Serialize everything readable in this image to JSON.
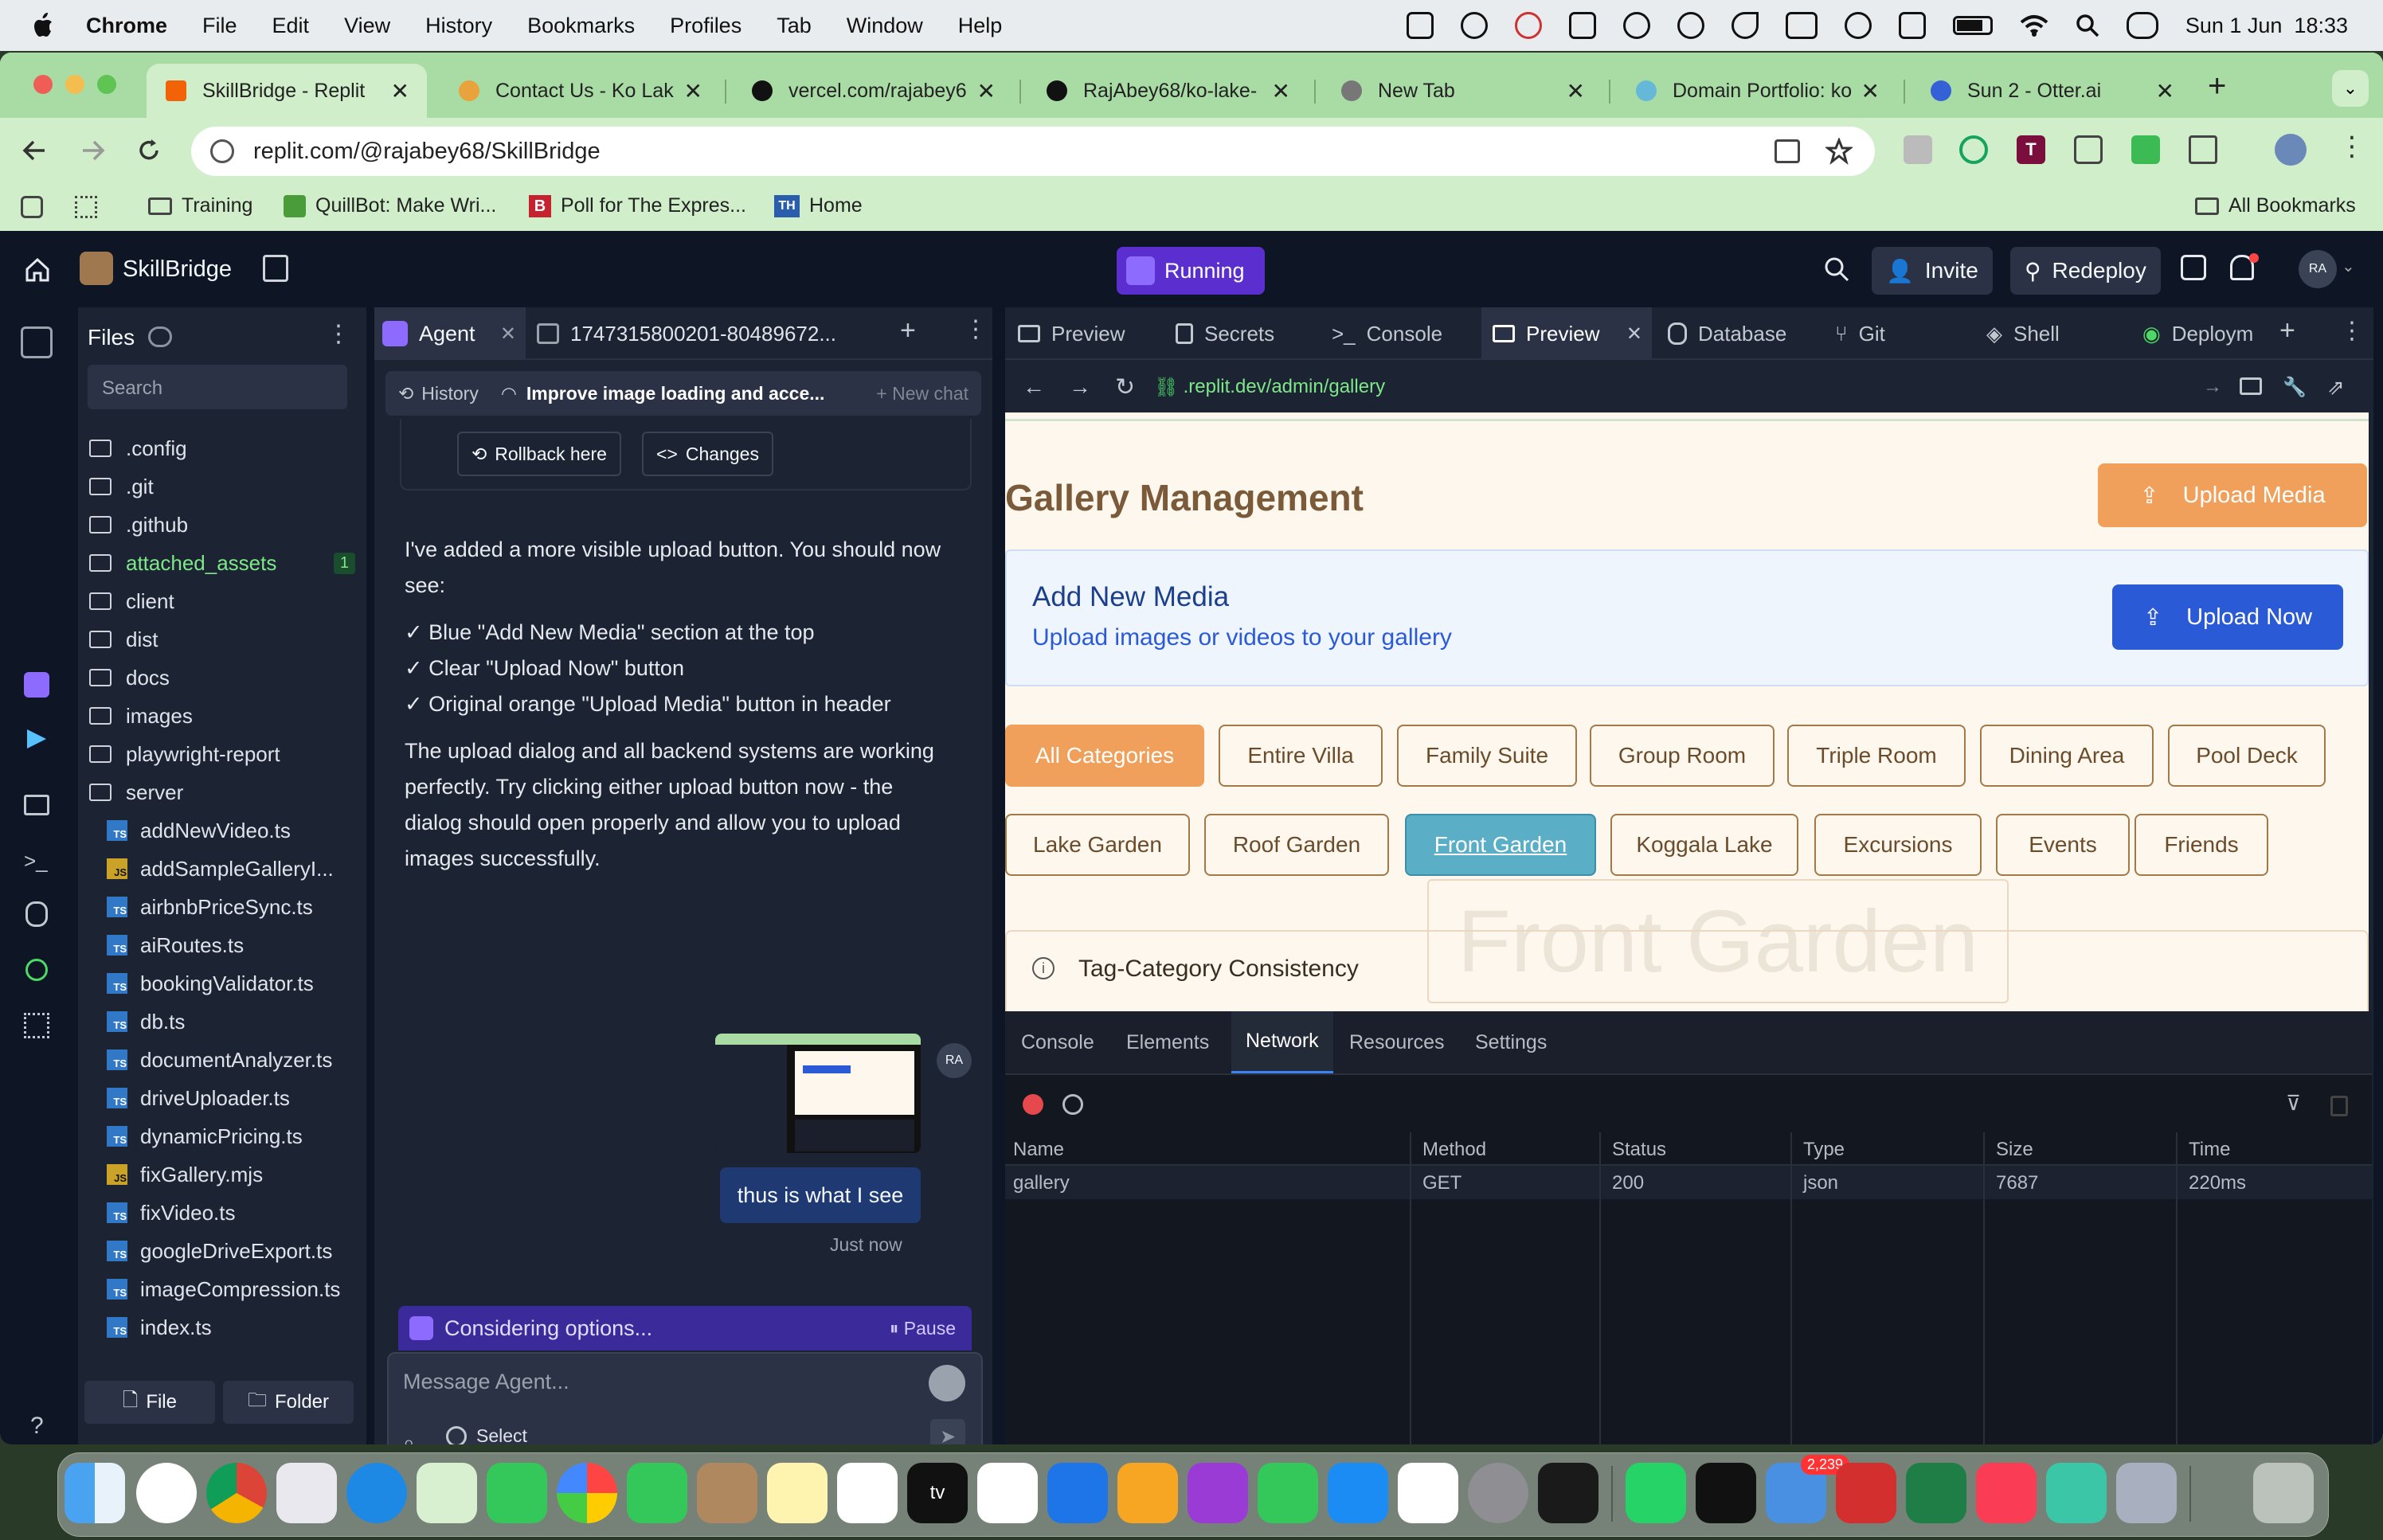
{
  "menubar": {
    "app": "Chrome",
    "items": [
      "File",
      "Edit",
      "View",
      "History",
      "Bookmarks",
      "Profiles",
      "Tab",
      "Window",
      "Help"
    ],
    "clock": "Sun 1 Jun  18:33"
  },
  "browser": {
    "tabs": [
      {
        "title": "SkillBridge - Replit",
        "favicon": "replit-icon",
        "color": "#f26207"
      },
      {
        "title": "Contact Us - Ko Lak",
        "favicon": "lake-icon",
        "color": "#e8a33d"
      },
      {
        "title": "vercel.com/rajabey6",
        "favicon": "vercel-icon",
        "color": "#111111"
      },
      {
        "title": "RajAbey68/ko-lake-",
        "favicon": "github-icon",
        "color": "#111111"
      },
      {
        "title": "New Tab",
        "favicon": "globe-icon",
        "color": "#555555"
      },
      {
        "title": "Domain Portfolio: ko",
        "favicon": "domain-icon",
        "color": "#66b8d8"
      },
      {
        "title": "Sun 2 - Otter.ai",
        "favicon": "otter-icon",
        "color": "#3561d6"
      }
    ],
    "url": "replit.com/@rajabey68/SkillBridge",
    "bookmarks": [
      "Training",
      "QuillBot: Make Wri...",
      "Poll for The Expres...",
      "Home"
    ],
    "all_bookmarks": "All Bookmarks"
  },
  "replit": {
    "project": "SkillBridge",
    "run_status": "Running",
    "invite": "Invite",
    "redeploy": "Redeploy",
    "avatar": "RA",
    "files": {
      "title": "Files",
      "search_placeholder": "Search",
      "folders": [
        ".config",
        ".git",
        ".github",
        "attached_assets",
        "client",
        "dist",
        "docs",
        "images",
        "playwright-report",
        "server"
      ],
      "attached_badge": "1",
      "server_files": [
        {
          "name": "addNewVideo.ts",
          "kind": "TS"
        },
        {
          "name": "addSampleGalleryI...",
          "kind": "JS"
        },
        {
          "name": "airbnbPriceSync.ts",
          "kind": "TS"
        },
        {
          "name": "aiRoutes.ts",
          "kind": "TS"
        },
        {
          "name": "bookingValidator.ts",
          "kind": "TS"
        },
        {
          "name": "db.ts",
          "kind": "TS"
        },
        {
          "name": "documentAnalyzer.ts",
          "kind": "TS"
        },
        {
          "name": "driveUploader.ts",
          "kind": "TS"
        },
        {
          "name": "dynamicPricing.ts",
          "kind": "TS"
        },
        {
          "name": "fixGallery.mjs",
          "kind": "JS"
        },
        {
          "name": "fixVideo.ts",
          "kind": "TS"
        },
        {
          "name": "googleDriveExport.ts",
          "kind": "TS"
        },
        {
          "name": "imageCompression.ts",
          "kind": "TS"
        },
        {
          "name": "index.ts",
          "kind": "TS"
        }
      ],
      "new_file": "File",
      "new_folder": "Folder"
    },
    "agent": {
      "tab_label": "Agent",
      "tab2_label": "1747315800201-80489672...",
      "history": "History",
      "chat_title": "Improve image loading and acce...",
      "new_chat": "New chat",
      "rollback": "Rollback here",
      "changes": "Changes",
      "message_intro": "I've added a more visible upload button. You should now see:",
      "checklist": [
        "✓ Blue \"Add New Media\" section at the top",
        "✓ Clear \"Upload Now\" button",
        "✓ Original orange \"Upload Media\" button in header"
      ],
      "message_outro": "The upload dialog and all backend systems are working perfectly. Try clicking either upload button now - the dialog should open properly and allow you to upload images successfully.",
      "user_message": "thus is what I see",
      "user_avatar": "RA",
      "timestamp": "Just now",
      "status": "Considering options...",
      "pause": "Pause",
      "input_placeholder": "Message Agent...",
      "select": "Select"
    },
    "pane_tabs": [
      "Preview",
      "Secrets",
      "Console",
      "Preview",
      "Database",
      "Git",
      "Shell",
      "Deploym"
    ],
    "preview": {
      "url": ".replit.dev/admin/gallery",
      "page_title": "Gallery Management",
      "upload_media": "Upload Media",
      "add_new_title": "Add New Media",
      "add_new_sub": "Upload images or videos to your gallery",
      "upload_now": "Upload Now",
      "categories_row1": [
        "All Categories",
        "Entire Villa",
        "Family Suite",
        "Group Room",
        "Triple Room",
        "Dining Area",
        "Pool Deck"
      ],
      "categories_row2": [
        "Lake Garden",
        "Roof Garden",
        "Front Garden",
        "Koggala Lake",
        "Excursions",
        "Events",
        "Friends"
      ],
      "watermark": "Front Garden",
      "consistency": "Tag-Category Consistency",
      "accent_orange": "#f0a05a",
      "accent_blue": "#2b5ad6"
    },
    "devtools": {
      "tabs": [
        "Console",
        "Elements",
        "Network",
        "Resources",
        "Settings"
      ],
      "columns": [
        "Name",
        "Method",
        "Status",
        "Type",
        "Size",
        "Time"
      ],
      "rows": [
        [
          "gallery",
          "GET",
          "200",
          "json",
          "7687",
          "220ms"
        ]
      ]
    }
  },
  "dock": {
    "mail_badge": "2,239"
  }
}
